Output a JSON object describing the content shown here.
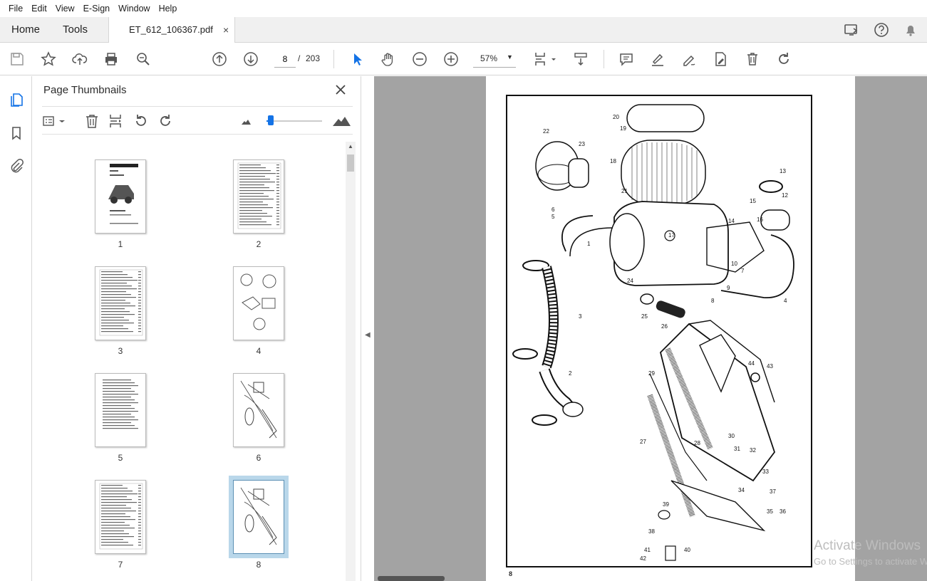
{
  "menu": [
    "File",
    "Edit",
    "View",
    "E-Sign",
    "Window",
    "Help"
  ],
  "tabs": {
    "home": "Home",
    "tools": "Tools",
    "document": "ET_612_106367.pdf",
    "close": "×"
  },
  "toolbar": {
    "page_current": "8",
    "page_separator": "/",
    "page_total": "203",
    "zoom": "57%",
    "zoom_arrow": "▼"
  },
  "panel": {
    "title": "Page Thumbnails",
    "thumb_size_percent": 8,
    "thumbnails": [
      {
        "label": "1",
        "kind": "cover"
      },
      {
        "label": "2",
        "kind": "table"
      },
      {
        "label": "3",
        "kind": "table"
      },
      {
        "label": "4",
        "kind": "figures"
      },
      {
        "label": "5",
        "kind": "text"
      },
      {
        "label": "6",
        "kind": "drawing"
      },
      {
        "label": "7",
        "kind": "table"
      },
      {
        "label": "8",
        "kind": "drawing",
        "selected": true
      }
    ]
  },
  "document": {
    "page_number": "8",
    "callouts": [
      "1",
      "2",
      "3",
      "4",
      "5",
      "6",
      "7",
      "8",
      "9",
      "10",
      "12",
      "13",
      "14",
      "15",
      "16",
      "17",
      "18",
      "19",
      "20",
      "21",
      "22",
      "23",
      "24",
      "25",
      "26",
      "27",
      "28",
      "29",
      "30",
      "31",
      "32",
      "33",
      "34",
      "35",
      "36",
      "37",
      "38",
      "39",
      "40",
      "41",
      "42",
      "43",
      "44"
    ]
  },
  "watermark": {
    "line1": "Activate Windows",
    "line2": "Go to Settings to activate Windows."
  },
  "colors": {
    "accent": "#1473e6",
    "doc_background": "#a3a3a3",
    "selection": "#b9d7ea"
  }
}
